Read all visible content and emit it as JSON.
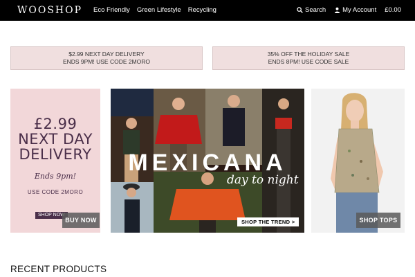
{
  "header": {
    "logo": "WOOSHOP",
    "nav": [
      "Eco Friendly",
      "Green Lifestyle",
      "Recycling"
    ],
    "search_label": "Search",
    "account_label": "My Account",
    "cart_total": "£0.00"
  },
  "promos": [
    {
      "line1": "$2.99 NEXT DAY DELIVERY",
      "line2": "ENDS 9PM! USE CODE 2MORO"
    },
    {
      "line1": "35% OFF THE HOLIDAY SALE",
      "line2": "ENDS 8PM! USE CODE SALE"
    }
  ],
  "banners": {
    "delivery": {
      "price": "£2.99",
      "line2": "NEXT DAY",
      "line3": "DELIVERY",
      "ends": "Ends 9pm!",
      "code": "USE CODE 2MORO",
      "shop_now": "SHOP NOW",
      "button": "BUY NOW",
      "bg_color": "#f2d7d9",
      "text_color": "#4b2f4a"
    },
    "mexicana": {
      "title": "MEXICANA",
      "subtitle": "day to night",
      "button": "SHOP THE TREND >"
    },
    "tops": {
      "button": "SHOP TOPS"
    }
  },
  "recent_products": {
    "title": "RECENT PRODUCTS"
  },
  "colors": {
    "topbar": "#000000",
    "promo_bg": "#f0dfdf",
    "overlay_button": "#5a5a5a"
  }
}
